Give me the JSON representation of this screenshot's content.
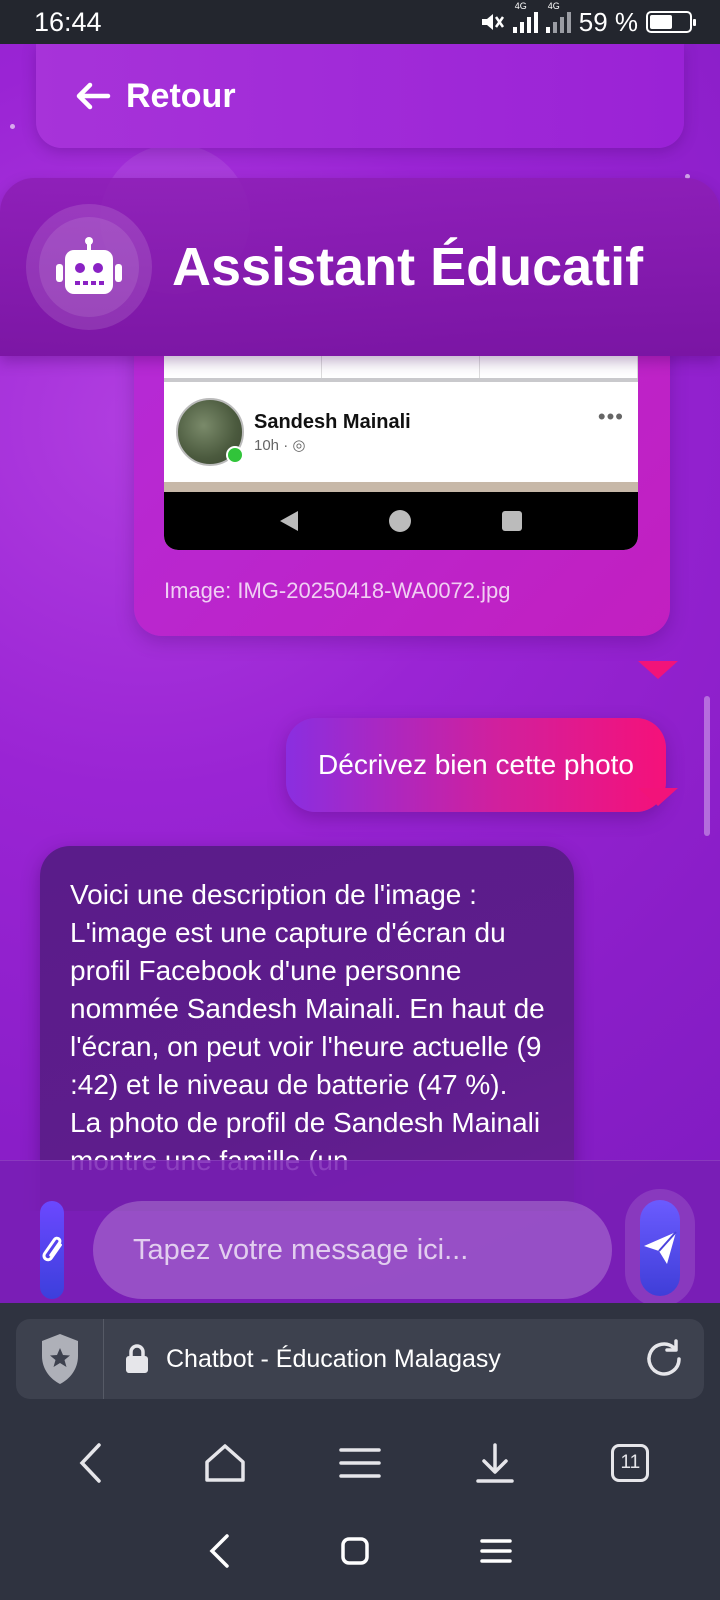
{
  "status_bar": {
    "time": "16:44",
    "network_label": "4G",
    "battery_percent": "59 %",
    "battery_level": 0.59
  },
  "header": {
    "back_label": "Retour",
    "title": "Assistant Éducatif",
    "bot_icon": "robot-icon"
  },
  "chat": {
    "image_message": {
      "fb_name": "Sandesh Mainali",
      "fb_time": "10h",
      "fb_more": "•••",
      "caption": "Image: IMG-20250418-WA0072.jpg"
    },
    "user_message": "Décrivez bien cette photo",
    "bot_message": "Voici une description de l'image : L'image est une capture d'écran du profil Facebook d'une personne nommée Sandesh Mainali. En haut de l'écran, on peut voir l'heure actuelle (9 :42) et le niveau de batterie (47 %). La photo de profil de Sandesh Mainali montre une famille (un"
  },
  "composer": {
    "placeholder": "Tapez votre message ici...",
    "attach_icon": "paperclip-icon",
    "send_icon": "send-icon"
  },
  "browser": {
    "page_title": "Chatbot - Éducation Malagasy",
    "tabs_count": "11"
  },
  "colors": {
    "accent_pink": "#f5117a",
    "purple_bg": "#9a24d4",
    "bot_bubble": "#5a1c8a"
  }
}
